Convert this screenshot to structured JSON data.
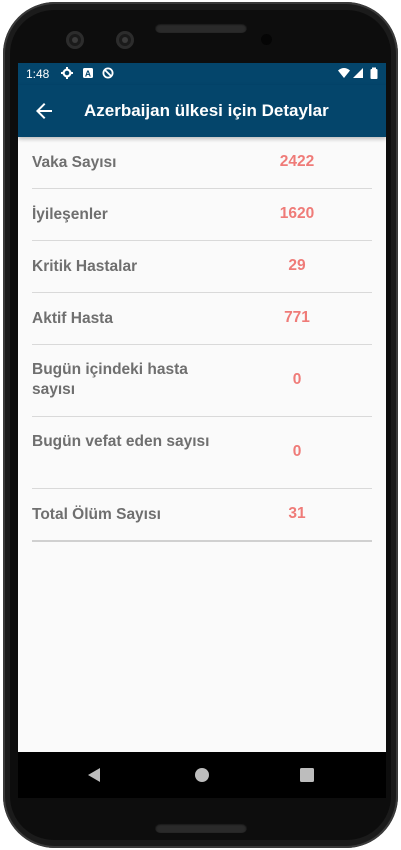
{
  "status_bar": {
    "time": "1:48",
    "icons": [
      "gear-icon",
      "a-badge-icon",
      "no-sync-icon",
      "wifi-icon",
      "signal-icon",
      "battery-icon"
    ]
  },
  "app_bar": {
    "back_icon": "back-arrow-icon",
    "title": "Azerbaijan ülkesi için Detaylar",
    "background": "#04456b"
  },
  "details": [
    {
      "label": "Vaka Sayısı",
      "value": "2422"
    },
    {
      "label": "İyileşenler",
      "value": "1620"
    },
    {
      "label": "Kritik Hastalar",
      "value": "29"
    },
    {
      "label": "Aktif Hasta",
      "value": "771"
    },
    {
      "label": "Bugün içindeki hasta sayısı",
      "value": "0"
    },
    {
      "label": "Bugün vefat eden sayısı",
      "value": "0"
    },
    {
      "label": "Total Ölüm Sayısı",
      "value": "31"
    }
  ],
  "colors": {
    "label": "#6f6f6f",
    "value": "#ef7b78"
  },
  "nav_bar": {
    "icons": [
      "nav-back-icon",
      "nav-home-icon",
      "nav-recents-icon"
    ]
  }
}
